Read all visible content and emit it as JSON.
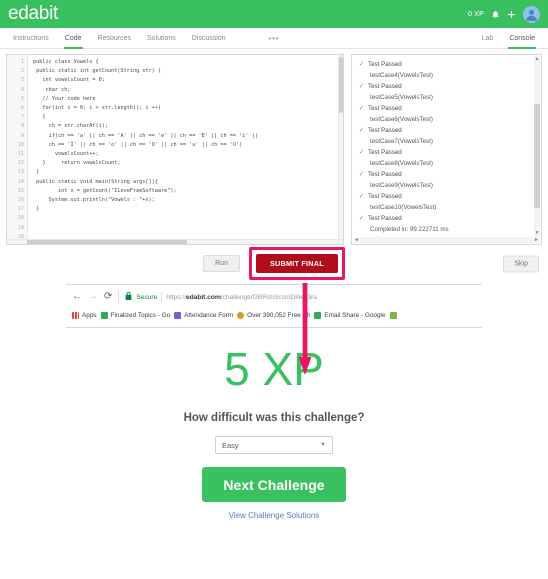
{
  "header": {
    "brand": "edabit",
    "xp": "0 XP",
    "bell_icon": "bell-icon",
    "plus_icon": "plus-icon",
    "avatar_icon": "user-avatar-icon"
  },
  "tabbar": {
    "left_tabs": [
      {
        "label": "Instructions",
        "active": false
      },
      {
        "label": "Code",
        "active": true
      },
      {
        "label": "Resources",
        "active": false
      },
      {
        "label": "Solutions",
        "active": false
      },
      {
        "label": "Discussion",
        "active": false
      }
    ],
    "overflow": "•••",
    "right_tabs": [
      {
        "label": "Lab",
        "active": false
      },
      {
        "label": "Console",
        "active": true
      }
    ]
  },
  "editor": {
    "line_numbers": [
      "1",
      "2",
      "3",
      "4",
      "5",
      "6",
      "7",
      "8",
      "9",
      "10",
      "11",
      "12",
      "13",
      "14",
      "15",
      "16",
      "17",
      "18",
      "19",
      "20"
    ],
    "lines": [
      "public class Vowels {",
      " public static int getCount(String str) {",
      "   int vowelsCount = 0;",
      "    char ch;",
      "   // Your code here",
      "",
      "   for(int i = 0; i < str.length(); i ++)",
      "   {",
      "     ch = str.charAt(i);",
      "",
      "     if(ch == 'a' || ch == 'A' || ch == 'e' || ch == 'E' || ch == 'i' ||",
      "     ch == 'I' || ch == 'o' || ch == 'O' || ch == 'u' || ch == 'U')",
      "",
      "       vowelsCount++;",
      "   }     return vowelsCount;",
      " }",
      " public static void main(String args[]){",
      "        int x = getCount(\"ILoveFreeSoftware\");",
      "     System.out.println(\"Vowels : \"+x);",
      " }  "
    ]
  },
  "console": {
    "entries": [
      {
        "status": "Test Passed",
        "detail": "testCase4(VowelsTest)"
      },
      {
        "status": "Test Passed",
        "detail": "testCase5(VowelsTest)"
      },
      {
        "status": "Test Passed",
        "detail": "testCase6(VowelsTest)"
      },
      {
        "status": "Test Passed",
        "detail": "testCase7(VowelsTest)"
      },
      {
        "status": "Test Passed",
        "detail": "testCase8(VowelsTest)"
      },
      {
        "status": "Test Passed",
        "detail": "testCase9(VowelsTest)"
      },
      {
        "status": "Test Passed",
        "detail": "testCase10(VowelsTest)"
      },
      {
        "status": "Test Passed",
        "detail": "Completed in: 99.222711 ms"
      }
    ],
    "check_glyph": "✓",
    "scroll_up": "▲",
    "scroll_down": "▼",
    "scroll_left": "◄",
    "scroll_right": "►"
  },
  "actions": {
    "run": "Run",
    "submit": "SUBMIT FINAL",
    "skip": "Skip",
    "highlight_color": "#ec1561",
    "submit_color": "#b00d1b"
  },
  "browser": {
    "back_icon": "←",
    "forward_icon": "→",
    "reload_icon": "⟳",
    "lock_icon": "🔒",
    "secure_label": "Secure",
    "url_scheme": "https://",
    "url_host": "edabit.com",
    "url_path": "/challenge/GBRshScsmDi9ek3ra",
    "apps_label": "Apps",
    "bookmarks": [
      {
        "label": "Finalized Topics - Go",
        "color": "#34a853"
      },
      {
        "label": "Attendance Form",
        "color": "#7b5cd6"
      },
      {
        "label": "Over 390,052 Free Ph",
        "color": "#c9a227"
      },
      {
        "label": "Email Share - Google",
        "color": "#34a853"
      },
      {
        "label": "",
        "color": "#7cb342"
      }
    ]
  },
  "result": {
    "xp_earned": "5 XP",
    "question": "How difficult was this challenge?",
    "difficulty_value": "Easy",
    "next_button": "Next Challenge",
    "solutions_link": "View Challenge Solutions",
    "accent_green": "#3ac15f"
  }
}
